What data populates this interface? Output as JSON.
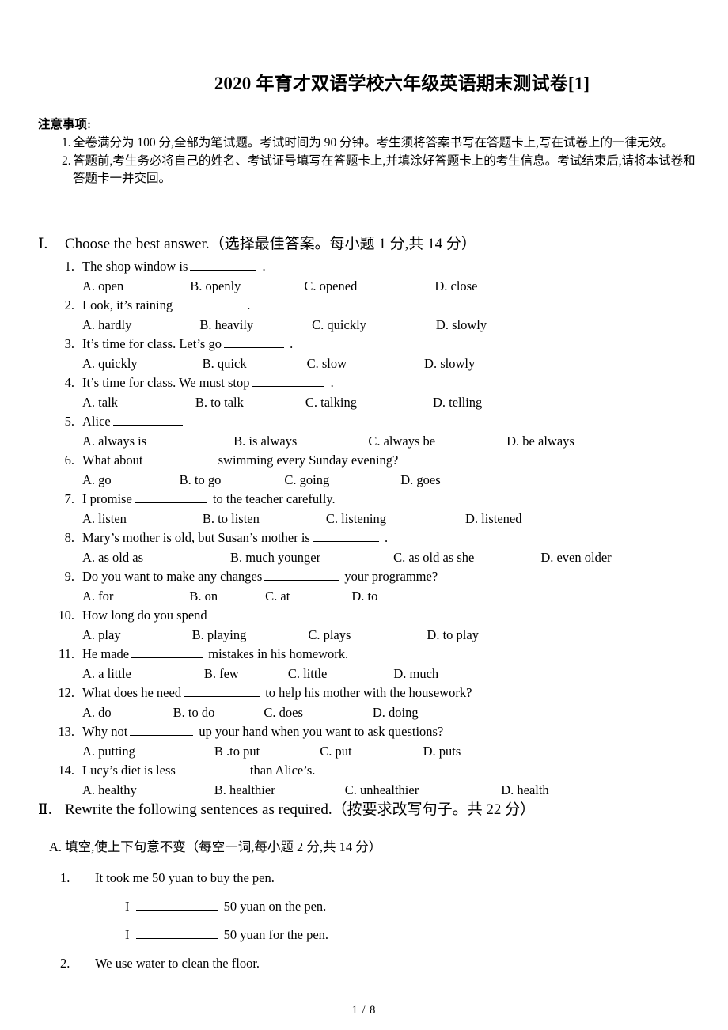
{
  "document": {
    "title": "2020 年育才双语学校六年级英语期末测试卷[1]",
    "footer_page": "1 / 8"
  },
  "notice": {
    "heading": "注意事项:",
    "items": [
      {
        "num": "1.",
        "text": "全卷满分为 100 分,全部为笔试题。考试时间为 90 分钟。考生须将答案书写在答题卡上,写在试卷上的一律无效。"
      },
      {
        "num": "2.",
        "text": "答题前,考生务必将自己的姓名、考试证号填写在答题卡上,并填涂好答题卡上的考生信息。考试结束后,请将本试卷和答题卡一并交回。"
      }
    ]
  },
  "sections": [
    {
      "roman": "Ⅰ.",
      "title": "Choose the best answer.（选择最佳答案。每小题 1 分,共 14 分）"
    },
    {
      "roman": "Ⅱ.",
      "title": "Rewrite the following sentences as required.（按要求改写句子。共 22 分）"
    }
  ],
  "part_a_heading": "A. 填空,使上下句意不变（每空一词,每小题 2 分,共 14 分）",
  "questions": [
    {
      "num": "1.",
      "pre": "The shop window is",
      "blank_width": 84,
      "post": ".",
      "options": [
        "A. open",
        "B. openly",
        "C. opened",
        "D. close"
      ],
      "opt_gaps": [
        0,
        84,
        80,
        98
      ]
    },
    {
      "num": "2.",
      "pre": "Look, it’s raining",
      "blank_width": 84,
      "post": ".",
      "options": [
        "A. hardly",
        "B. heavily",
        "C. quickly",
        "D. slowly"
      ],
      "opt_gaps": [
        0,
        86,
        74,
        88
      ]
    },
    {
      "num": "3.",
      "pre": "It’s time for class. Let’s go",
      "blank_width": 76,
      "post": ".",
      "options": [
        "A. quickly",
        "B. quick",
        "C. slow",
        "D. slowly"
      ],
      "opt_gaps": [
        0,
        82,
        76,
        98
      ]
    },
    {
      "num": "4.",
      "pre": "It’s time for class. We must stop",
      "blank_width": 92,
      "post": ".",
      "options": [
        "A. talk",
        "B. to talk",
        "C. talking",
        "D. telling"
      ],
      "opt_gaps": [
        0,
        98,
        78,
        96
      ]
    },
    {
      "num": "5.",
      "pre": "Alice",
      "blank_width": 88,
      "post": "",
      "options": [
        "A. always is",
        "B. is always",
        "C. always be",
        "D. be always"
      ],
      "opt_gaps": [
        0,
        110,
        90,
        90
      ]
    },
    {
      "num": "6.",
      "pre": "What about",
      "blank_width": 88,
      "post": "swimming every Sunday evening?",
      "tight": true,
      "options": [
        "A. go",
        "B. to go",
        "C. going",
        "D. goes"
      ],
      "opt_gaps": [
        0,
        86,
        80,
        90
      ]
    },
    {
      "num": "7.",
      "pre": "I promise",
      "blank_width": 92,
      "post": "to the teacher carefully.",
      "options": [
        "A. listen",
        "B. to listen",
        "C. listening",
        "D. listened"
      ],
      "opt_gaps": [
        0,
        96,
        84,
        100
      ]
    },
    {
      "num": "8.",
      "pre": "Mary’s mother is old, but Susan’s mother is",
      "blank_width": 84,
      "post": ".",
      "options": [
        "A. as old as",
        "B. much younger",
        "C. as old as she",
        "D. even older"
      ],
      "opt_gaps": [
        0,
        110,
        92,
        84
      ]
    },
    {
      "num": "9.",
      "pre": "Do you want to make any changes",
      "blank_width": 94,
      "post": "your programme?",
      "options": [
        "A. for",
        "B. on",
        "C. at",
        "D. to"
      ],
      "opt_gaps": [
        0,
        96,
        60,
        78
      ]
    },
    {
      "num": "10.",
      "pre": "How long do you spend",
      "blank_width": 94,
      "post": "",
      "options": [
        "A. play",
        "B. playing",
        "C. plays",
        "D. to play"
      ],
      "opt_gaps": [
        0,
        90,
        78,
        96
      ]
    },
    {
      "num": "11.",
      "pre": "He made",
      "blank_width": 90,
      "post": "mistakes in his homework.",
      "options": [
        "A. a little",
        "B. few",
        "C. little",
        "D. much"
      ],
      "opt_gaps": [
        0,
        92,
        62,
        84
      ]
    },
    {
      "num": "12.",
      "pre": "What does he need",
      "blank_width": 96,
      "post": "to help his mother with the housework?",
      "options": [
        "A. do",
        "B. to do",
        "C. does",
        "D. doing"
      ],
      "opt_gaps": [
        0,
        78,
        62,
        88
      ]
    },
    {
      "num": "13.",
      "pre": "Why not",
      "blank_width": 80,
      "post": "up your hand when you want to ask questions?",
      "options": [
        "A. putting",
        "B .to put",
        "C. put",
        "D. puts"
      ],
      "opt_gaps": [
        0,
        100,
        76,
        90
      ]
    },
    {
      "num": "14.",
      "pre": "Lucy’s diet is less",
      "blank_width": 84,
      "post": "than Alice’s.",
      "options": [
        "A. healthy",
        "B. healthier",
        "C. unhealthier",
        "D. health"
      ],
      "opt_gaps": [
        0,
        98,
        88,
        104
      ]
    }
  ],
  "rewrites": [
    {
      "num": "1.",
      "sentence": "It took me 50 yuan to buy the pen.",
      "answers": [
        {
          "pre": "I",
          "blank_width": 104,
          "post": "50 yuan on the pen."
        },
        {
          "pre": "I",
          "blank_width": 104,
          "post": "50 yuan for the pen."
        }
      ]
    },
    {
      "num": "2.",
      "sentence": "We use water to clean the floor.",
      "answers": []
    }
  ]
}
